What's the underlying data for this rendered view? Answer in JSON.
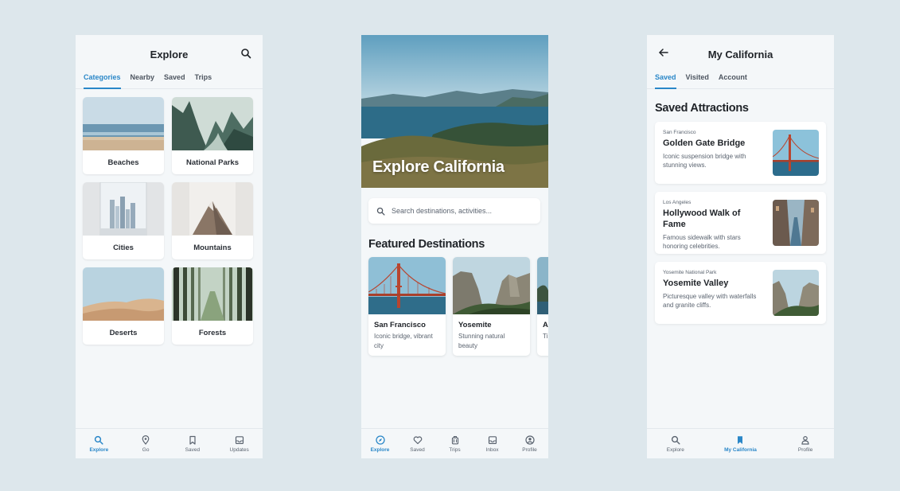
{
  "screen1": {
    "title": "Explore",
    "tabs": [
      "Categories",
      "Nearby",
      "Saved",
      "Trips"
    ],
    "categories": [
      "Beaches",
      "National Parks",
      "Cities",
      "Mountains",
      "Deserts",
      "Forests"
    ],
    "nav": [
      "Explore",
      "Go",
      "Saved",
      "Updates"
    ]
  },
  "screen2": {
    "hero_title": "Explore California",
    "search_placeholder": "Search destinations, activities...",
    "section_title": "Featured Destinations",
    "destinations": [
      {
        "name": "San Francisco",
        "desc": "Iconic bridge, vibrant city"
      },
      {
        "name": "Yosemite",
        "desc": "Stunning natural beauty"
      },
      {
        "name": "A",
        "desc": "Ti n"
      }
    ],
    "nav": [
      "Explore",
      "Saved",
      "Trips",
      "Inbox",
      "Profile"
    ]
  },
  "screen3": {
    "title": "My California",
    "tabs": [
      "Saved",
      "Visited",
      "Account"
    ],
    "section_title": "Saved Attractions",
    "attractions": [
      {
        "location": "San Francisco",
        "name": "Golden Gate Bridge",
        "desc": "Iconic suspension bridge with stunning views."
      },
      {
        "location": "Los Angeles",
        "name": "Hollywood Walk of Fame",
        "desc": "Famous sidewalk with stars honoring celebrities."
      },
      {
        "location": "Yosemite National Park",
        "name": "Yosemite Valley",
        "desc": "Picturesque valley with waterfalls and granite cliffs."
      }
    ],
    "nav": [
      "Explore",
      "My California",
      "Profile"
    ]
  },
  "colors": {
    "accent": "#2a87c8",
    "background": "#dde7ec",
    "screen": "#f4f7f9"
  }
}
